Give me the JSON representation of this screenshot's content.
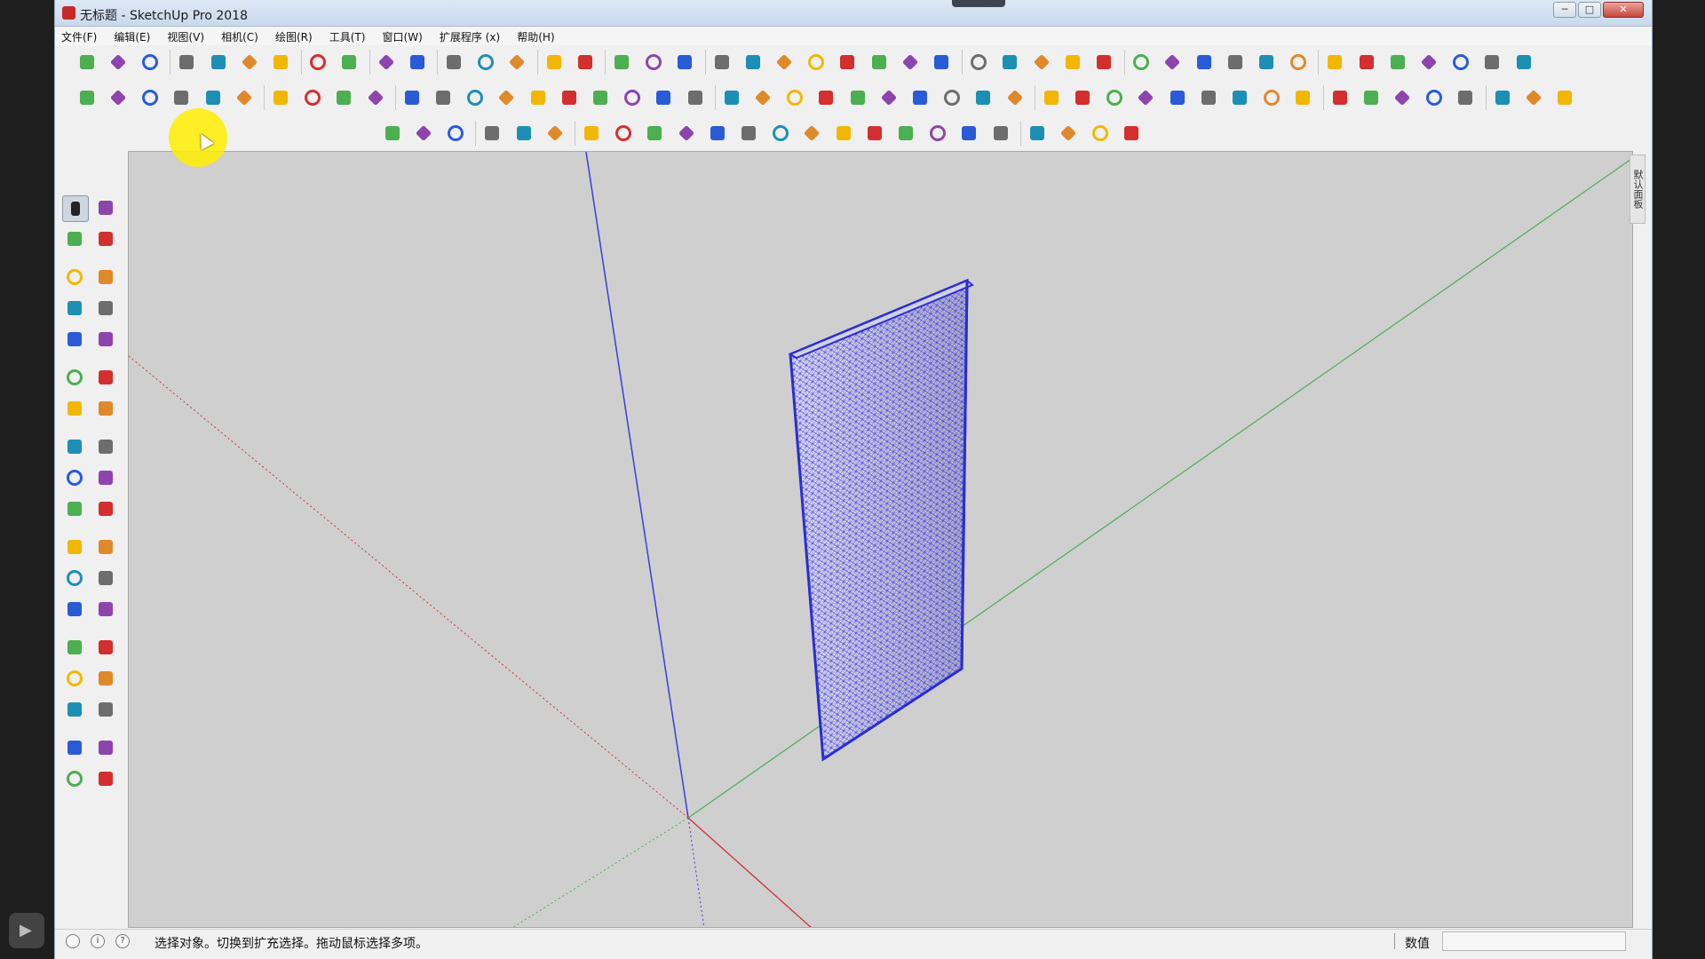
{
  "window": {
    "title": "无标题 - SketchUp Pro 2018",
    "minimize_glyph": "─",
    "maximize_glyph": "□",
    "close_glyph": "✕"
  },
  "menubar": {
    "items": [
      "文件(F)",
      "编辑(E)",
      "视图(V)",
      "相机(C)",
      "绘图(R)",
      "工具(T)",
      "窗口(W)",
      "扩展程序 (x)",
      "帮助(H)"
    ]
  },
  "colors": {
    "accent_red": "#d32f2f",
    "accent_blue": "#2a5bd7",
    "accent_orange": "#e0892b",
    "axis_blue": "#3b3bdf",
    "axis_green": "#4caf50",
    "axis_red": "#d32f2f",
    "wall_wire": "#2b2bd8",
    "viewport_bg": "#cfcfcf",
    "highlight": "#ffee00"
  },
  "toolbar_main": {
    "icons": [
      "new-file-icon",
      "open-icon",
      "save-icon",
      "cut-icon",
      "paint-bucket-icon",
      "paste-icon",
      "delete-icon",
      "undo-icon",
      "redo-icon",
      "print-icon",
      "model-info-icon",
      "check-validity-icon",
      "teapot-icon",
      "teapot-hand-icon",
      "align-icon",
      "section-plane-icon",
      "window-icon",
      "cube-window-icon",
      "lock-icon",
      "funnel-icon",
      "target-icon",
      "angle-icon",
      "pin-icon",
      "sparkle-icon",
      "half-dome-icon",
      "sphere-icon",
      "sun-icon",
      "terrain-icon",
      "box-icon",
      "open-box-icon",
      "grass-icon",
      "eraser-soft-icon",
      "house-3d-icon",
      "panel-icon",
      "house-icon",
      "house-outline-icon",
      "home-icon",
      "store-icon",
      "cube-blue-icon",
      "cube-outline-icon",
      "cube-hidden-icon",
      "cube-shaded-icon",
      "cube-textured-icon",
      "layers-icon",
      "cube-mono-icon"
    ]
  },
  "toolbar_second": {
    "icons": [
      "solid-blue-icon",
      "solid-light-blue-icon",
      "solid-yellow-icon",
      "solid-green-icon",
      "solid-red-icon",
      "solid-outline-icon",
      "orange-spin-icon",
      "red-square-icon",
      "grid-square-icon",
      "flag-icon",
      "wood-block-icon",
      "spline-icon",
      "curve-pen-icon",
      "dots-line-icon",
      "cross-red-icon",
      "cross-green-icon",
      "cross-blue-icon",
      "cone-icon",
      "cone-dup-icon",
      "warning-cone-icon",
      "rotate-yellow-icon",
      "rotate-orange-icon",
      "rotate-dark-icon",
      "move-arrows-icon",
      "bucket-icon",
      "u-turn-icon",
      "bracket-green-icon",
      "array-icon",
      "cluster-icon",
      "fan-icon",
      "red-gem-icon",
      "network-icon",
      "frame-icon",
      "orange-grid-icon",
      "orange-grid-2-icon",
      "orange-grid-3-icon",
      "x-mark-icon",
      "dotted-curve-icon",
      "node-graph-icon",
      "sphere-outline-icon",
      "search-3d-icon",
      "sphere-grey-icon",
      "cut-cube-icon",
      "red-plane-icon",
      "shade-active-icon",
      "pencil-stand-icon",
      "help-icon"
    ]
  },
  "toolbar_third": {
    "icons": [
      "cube-frame-icon",
      "cube-solid-blue-icon",
      "cube-wire-icon",
      "shield-icon",
      "color-boxes-icon",
      "star-net-icon",
      "arch-icon",
      "line-icon",
      "zigzag-icon",
      "wave-icon",
      "bezier-icon",
      "arc-green-icon",
      "square-icon",
      "circle-icon",
      "quarter-arc-icon",
      "polyline-icon",
      "hook-icon",
      "curve-icon",
      "red-arc-icon",
      "polyline-green-icon",
      "gear-icon",
      "wrench-icon",
      "red-ring-icon",
      "red-fan-icon"
    ]
  },
  "left_toolbar": {
    "icons": [
      "select-arrow-icon",
      "component-icon",
      "paint-bucket-icon",
      "eraser-icon",
      "pencil-icon",
      "freehand-icon",
      "rectangle-icon",
      "rotated-rect-icon",
      "circle-icon",
      "polygon-icon",
      "arc-icon",
      "two-point-arc-icon",
      "three-point-arc-icon",
      "pie-icon",
      "move-icon",
      "push-pull-icon",
      "rotate-icon",
      "follow-me-icon",
      "scale-icon",
      "offset-icon",
      "tape-measure-icon",
      "dimension-icon",
      "protractor-icon",
      "text-icon",
      "axes-icon",
      "3d-text-icon",
      "orbit-icon",
      "pan-icon",
      "zoom-icon",
      "zoom-window-icon",
      "zoom-extents-icon",
      "previous-view-icon",
      "position-camera-icon",
      "look-around-icon",
      "walk-icon",
      "section-icon"
    ],
    "active_index": 0
  },
  "tray": {
    "tab_label": "默认面板"
  },
  "statusbar": {
    "status_text": "选择对象。切换到扩充选择。拖动鼠标选择多项。",
    "vcb_label": "数值",
    "vcb_value": "",
    "info_icon": "i",
    "user_icon": "?"
  }
}
